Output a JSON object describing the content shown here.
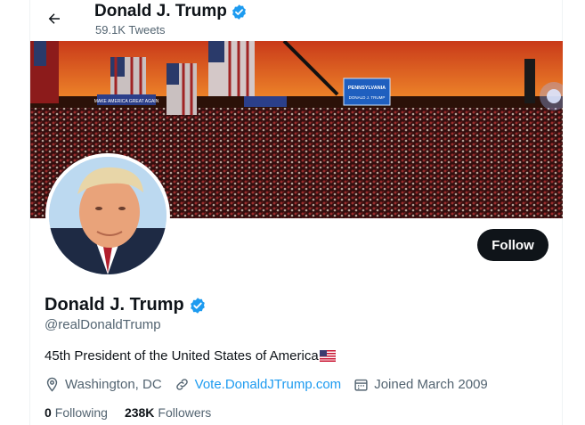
{
  "header": {
    "back_icon": "arrow-left-icon",
    "name": "Donald J. Trump",
    "tweets": "59.1K Tweets"
  },
  "banner": {
    "sign_main": "PENNSYLVANIA",
    "sign_sub": "DONALD J. TRUMP",
    "banner_left": "MAKE AMERICA GREAT AGAIN"
  },
  "profile": {
    "name": "Donald J. Trump",
    "handle": "@realDonaldTrump",
    "follow_label": "Follow",
    "bio": "45th President of the United States of America",
    "location": "Washington, DC",
    "website": "Vote.DonaldJTrump.com",
    "joined": "Joined March 2009",
    "following_count": "0",
    "following_label": "Following",
    "followers_count": "238K",
    "followers_label": "Followers"
  },
  "colors": {
    "accent": "#1d9bf0",
    "verified": "#1d9bf0",
    "follow_bg": "#0f1419"
  }
}
